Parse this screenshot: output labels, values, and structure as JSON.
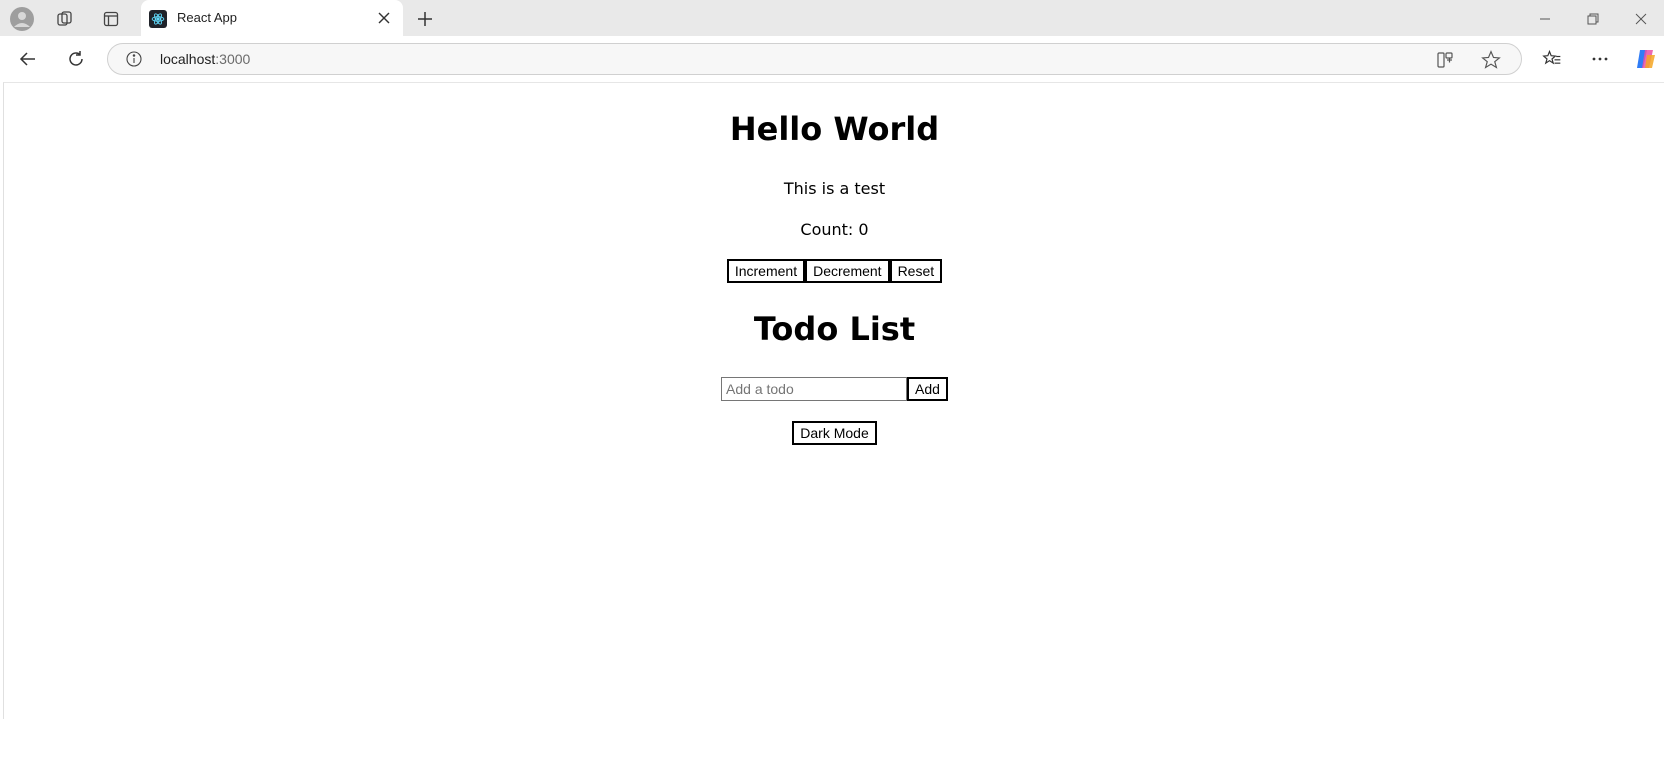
{
  "browser": {
    "tab": {
      "title": "React App"
    },
    "address": {
      "host": "localhost",
      "port": ":3000"
    },
    "icons": {
      "profile": "profile-icon",
      "workspaces": "workspaces-icon",
      "tab_actions": "tab-actions-icon",
      "favicon": "react-favicon-icon",
      "close_tab": "close-icon",
      "new_tab": "plus-icon",
      "back": "back-arrow-icon",
      "refresh": "refresh-icon",
      "site_info": "info-icon",
      "split_screen": "split-screen-icon",
      "favorite": "star-icon",
      "favorites": "favorites-icon",
      "more": "more-icon",
      "copilot": "copilot-icon"
    }
  },
  "app": {
    "heading": "Hello World",
    "subtitle": "This is a test",
    "count_text": "Count: 0",
    "buttons": {
      "increment": "Increment",
      "decrement": "Decrement",
      "reset": "Reset"
    },
    "todo": {
      "heading": "Todo List",
      "input_placeholder": "Add a todo",
      "input_value": "",
      "add_label": "Add"
    },
    "dark_mode_label": "Dark Mode"
  }
}
